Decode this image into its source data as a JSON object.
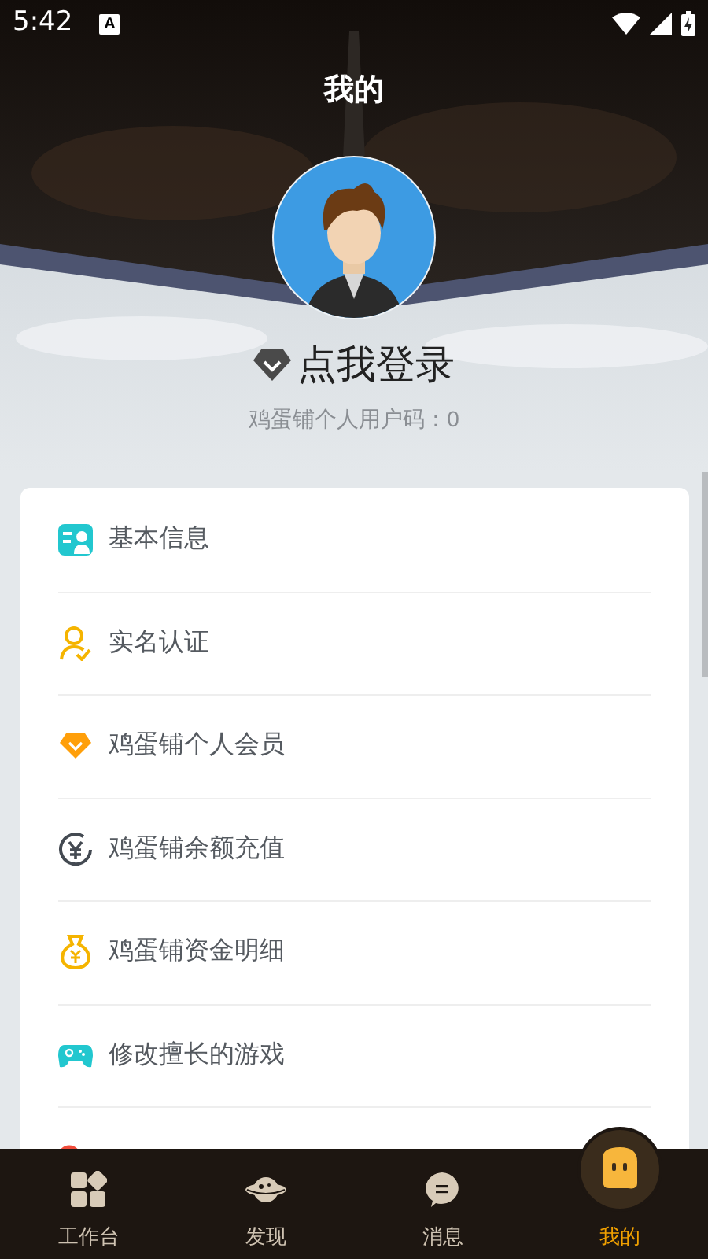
{
  "status_bar": {
    "time": "5:42",
    "notification": "A"
  },
  "header": {
    "title": "我的"
  },
  "profile": {
    "login": "点我登录",
    "user_code": "鸡蛋铺个人用户码：0"
  },
  "menu": [
    {
      "label": "基本信息"
    },
    {
      "label": "实名认证"
    },
    {
      "label": "鸡蛋铺个人会员"
    },
    {
      "label": "鸡蛋铺余额充值"
    },
    {
      "label": "鸡蛋铺资金明细"
    },
    {
      "label": "修改擅长的游戏"
    }
  ],
  "tab_bar": [
    {
      "label": "工作台",
      "selected": false
    },
    {
      "label": "发现",
      "selected": false
    },
    {
      "label": "消息",
      "selected": false
    },
    {
      "label": "我的",
      "selected": true
    }
  ]
}
